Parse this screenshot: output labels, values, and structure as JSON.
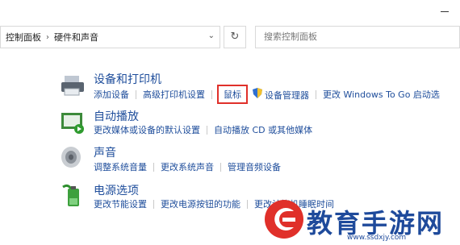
{
  "address": {
    "crumb1": "控制面板",
    "separator": "›",
    "crumb2": "硬件和声音",
    "dropdown": "⌄",
    "refresh": "↻"
  },
  "search": {
    "placeholder": "搜索控制面板"
  },
  "devices": {
    "title": "设备和打印机",
    "links": [
      "添加设备",
      "高级打印机设置",
      "鼠标",
      "设备管理器",
      "更改 Windows To Go 启动选"
    ]
  },
  "autoplay": {
    "title": "自动播放",
    "links": [
      "更改媒体或设备的默认设置",
      "自动播放 CD 或其他媒体"
    ]
  },
  "sound": {
    "title": "声音",
    "links": [
      "调整系统音量",
      "更改系统声音",
      "管理音频设备"
    ]
  },
  "power": {
    "title": "电源选项",
    "links": [
      "更改节能设置",
      "更改电源按钮的功能",
      "更改计算机睡眠时间"
    ]
  },
  "watermark": {
    "text": "教育手游网",
    "url": "www.ssdxjy.com"
  },
  "colors": {
    "link": "#1e4d9b",
    "highlight": "#e0302a",
    "watermark": "#1e4a9b"
  }
}
